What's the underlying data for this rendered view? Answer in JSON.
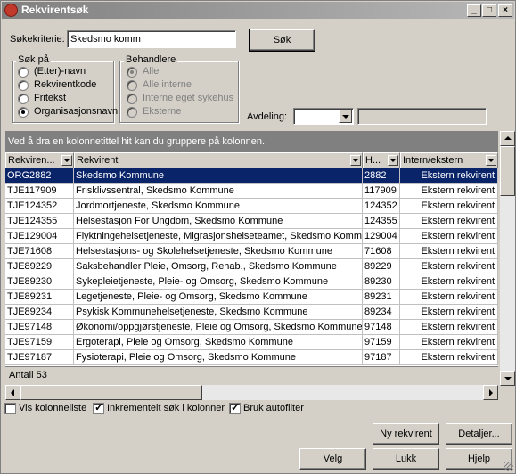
{
  "window": {
    "title": "Rekvirentsøk",
    "minimize_label": "_",
    "maximize_label": "□",
    "close_label": "×"
  },
  "search": {
    "label": "Søkekriterie:",
    "value": "Skedsmo komm",
    "search_button": "Søk"
  },
  "search_on": {
    "title": "Søk på",
    "options": [
      {
        "label": "(Etter)-navn",
        "checked": false
      },
      {
        "label": "Rekvirentkode",
        "checked": false
      },
      {
        "label": "Fritekst",
        "checked": false
      },
      {
        "label": "Organisasjonsnavn",
        "checked": true
      }
    ]
  },
  "handlers": {
    "title": "Behandlere",
    "options": [
      {
        "label": "Alle",
        "checked": true,
        "disabled": true
      },
      {
        "label": "Alle interne",
        "checked": false,
        "disabled": true
      },
      {
        "label": "Interne eget sykehus",
        "checked": false,
        "disabled": true
      },
      {
        "label": "Eksterne",
        "checked": false,
        "disabled": true
      }
    ]
  },
  "department": {
    "label": "Avdeling:",
    "value": "",
    "text_value": ""
  },
  "group_hint": "Ved å dra en kolonnetittel hit kan du gruppere på kolonnen.",
  "grid": {
    "columns": [
      "Rekviren...",
      "Rekvirent",
      "H...",
      "Intern/ekstern"
    ],
    "rows": [
      [
        "ORG2882",
        "Skedsmo Kommune",
        "2882",
        "Ekstern rekvirent"
      ],
      [
        "TJE117909",
        "Frisklivssentral, Skedsmo Kommune",
        "117909",
        "Ekstern rekvirent"
      ],
      [
        "TJE124352",
        "Jordmortjeneste, Skedsmo Kommune",
        "124352",
        "Ekstern rekvirent"
      ],
      [
        "TJE124355",
        "Helsestasjon For Ungdom, Skedsmo Kommune",
        "124355",
        "Ekstern rekvirent"
      ],
      [
        "TJE129004",
        "Flyktningehelsetjeneste, Migrasjonshelseteamet, Skedsmo Kommune",
        "129004",
        "Ekstern rekvirent"
      ],
      [
        "TJE71608",
        "Helsestasjons- og Skolehelsetjeneste, Skedsmo Kommune",
        "71608",
        "Ekstern rekvirent"
      ],
      [
        "TJE89229",
        "Saksbehandler Pleie, Omsorg, Rehab., Skedsmo Kommune",
        "89229",
        "Ekstern rekvirent"
      ],
      [
        "TJE89230",
        "Sykepleietjeneste, Pleie- og Omsorg, Skedsmo Kommune",
        "89230",
        "Ekstern rekvirent"
      ],
      [
        "TJE89231",
        "Legetjeneste, Pleie- og Omsorg, Skedsmo Kommune",
        "89231",
        "Ekstern rekvirent"
      ],
      [
        "TJE89234",
        "Psykisk Kommunehelsetjeneste, Skedsmo Kommune",
        "89234",
        "Ekstern rekvirent"
      ],
      [
        "TJE97148",
        "Økonomi/oppgjørstjeneste, Pleie og Omsorg, Skedsmo Kommune",
        "97148",
        "Ekstern rekvirent"
      ],
      [
        "TJE97159",
        "Ergoterapi, Pleie og Omsorg, Skedsmo Kommune",
        "97159",
        "Ekstern rekvirent"
      ],
      [
        "TJE97187",
        "Fysioterapi, Pleie og Omsorg, Skedsmo Kommune",
        "97187",
        "Ekstern rekvirent"
      ]
    ],
    "selected_row": 0,
    "count_label": "Antall 53"
  },
  "options": {
    "show_column_list": {
      "label": "Vis kolonneliste",
      "checked": false
    },
    "incremental_search": {
      "label": "Inkrementelt søk i kolonner",
      "checked": true
    },
    "autofilter": {
      "label": "Bruk autofilter",
      "checked": true
    }
  },
  "buttons": {
    "new_requester": "Ny rekvirent",
    "details": "Detaljer...",
    "select": "Velg",
    "close": "Lukk",
    "help": "Hjelp"
  },
  "colors": {
    "selection": "#0a246a",
    "face": "#d4d0c8",
    "group_bar": "#808080"
  }
}
